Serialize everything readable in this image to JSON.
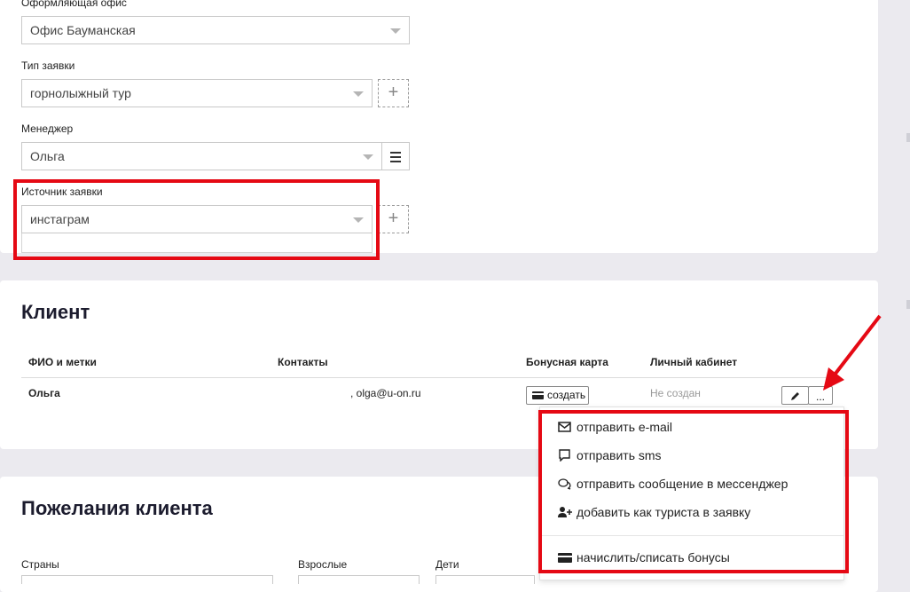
{
  "request": {
    "office_label": "Оформляющая офис",
    "office_value": "Офис Бауманская",
    "type_label": "Тип заявки",
    "type_value": "горнолыжный тур",
    "type_add": "+",
    "manager_label": "Менеджер",
    "manager_value": "Ольга",
    "source_label": "Источник заявки",
    "source_value": "инстаграм",
    "source_add": "+"
  },
  "client": {
    "title": "Клиент",
    "columns": [
      "ФИО и метки",
      "Контакты",
      "Бонусная карта",
      "Личный кабинет"
    ],
    "row": {
      "name": "Ольга",
      "contacts": ", olga@u-on.ru",
      "bonus_button": "создать",
      "cabinet": "Не создан",
      "more_button": "..."
    }
  },
  "menu": {
    "items": [
      {
        "icon": "envelope-icon",
        "label": "отправить e-mail"
      },
      {
        "icon": "speech-bubble-icon",
        "label": "отправить sms"
      },
      {
        "icon": "chat-bubbles-icon",
        "label": "отправить сообщение в мессенджер"
      },
      {
        "icon": "user-plus-icon",
        "label": "добавить как туриста в заявку"
      },
      {
        "icon": "credit-card-icon",
        "label": "начислить/списать бонусы"
      }
    ]
  },
  "wishes": {
    "title": "Пожелания клиента",
    "countries_label": "Страны",
    "adults_label": "Взрослые",
    "children_label": "Дети"
  },
  "colors": {
    "highlight": "#e50914",
    "background": "#ebeaef",
    "panel": "#ffffff"
  }
}
